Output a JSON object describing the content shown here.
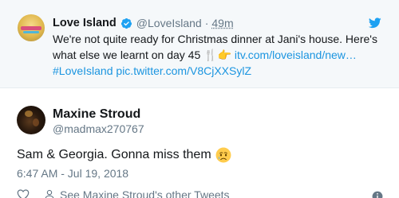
{
  "quoted_tweet": {
    "author_name": "Love Island",
    "handle": "@LoveIsland",
    "separator": "·",
    "time": "49m",
    "text_line1": "We're not quite ready for Christmas dinner at Jani's house. Here's",
    "text_line2_start": "what else we learnt on day 45",
    "emojis": "🍴👉",
    "link": "itv.com/loveisland/new…",
    "hashtag": "#LoveIsland",
    "pic_link": "pic.twitter.com/V8CjXXSylZ",
    "avatar_icon": "love-island-logo-icon",
    "verified_icon": "verified-badge-icon",
    "platform_icon": "twitter-bird-icon"
  },
  "tweet": {
    "author_name": "Maxine Stroud",
    "handle": "@madmax270767",
    "text": "Sam & Georgia. Gonna miss them",
    "emoji_icon": "crying-face-icon",
    "timestamp": "6:47 AM - Jul 19, 2018"
  },
  "actions": {
    "like_icon": "heart-icon",
    "profile_icon": "person-icon",
    "other_tweets_label": "See Maxine Stroud's other Tweets",
    "info_icon": "info-icon"
  },
  "colors": {
    "link": "#1b95e0",
    "muted": "#657786",
    "text": "#14171a",
    "quoted_bg": "#f5f8fa"
  }
}
